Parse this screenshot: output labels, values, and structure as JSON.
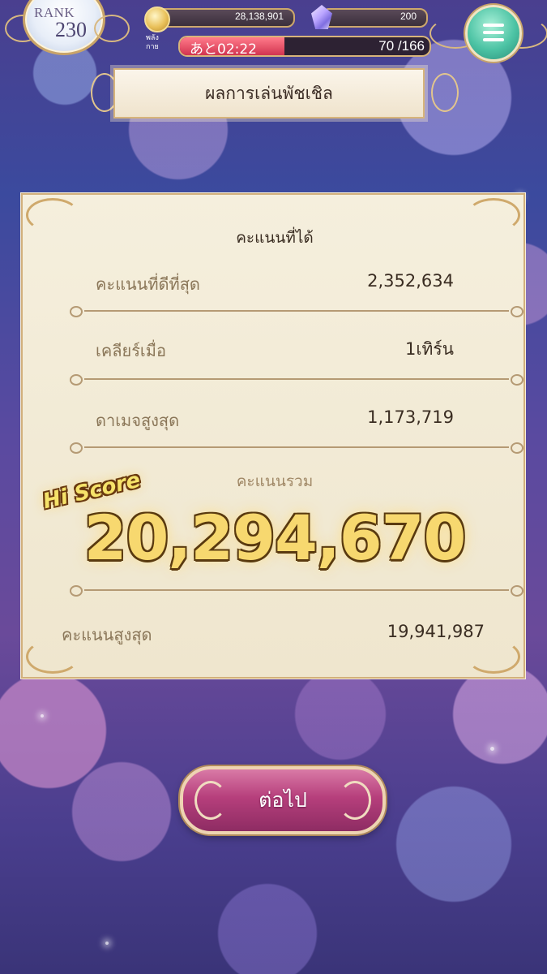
{
  "hud": {
    "rank_label": "RANK",
    "rank_value": "230",
    "coins": "28,138,901",
    "crystals": "200",
    "stamina_label_line1": "พลัง",
    "stamina_label_line2": "กาย",
    "stamina_timer": "あと02:22",
    "stamina_count": "70 /166",
    "stamina_fraction": 0.42
  },
  "title": "ผลการเล่นพัชเชิล",
  "results": {
    "heading": "คะแนนที่ได้",
    "rows": [
      {
        "label": "คะแนนที่ดีที่สุด",
        "value": "2,352,634"
      },
      {
        "label": "เคลียร์เมื่อ",
        "value": "1เทิร์น"
      },
      {
        "label": "ดาเมจสูงสุด",
        "value": "1,173,719"
      }
    ],
    "total_heading": "คะแนนรวม",
    "hi_score_badge": "Hi Score",
    "total_score": "20,294,670",
    "best_label": "คะแนนสูงสุด",
    "best_value": "19,941,987"
  },
  "next_button": "ต่อไป",
  "icons": {
    "coin": "coin-icon",
    "crystal": "crystal-icon",
    "menu": "hamburger-menu-icon"
  }
}
